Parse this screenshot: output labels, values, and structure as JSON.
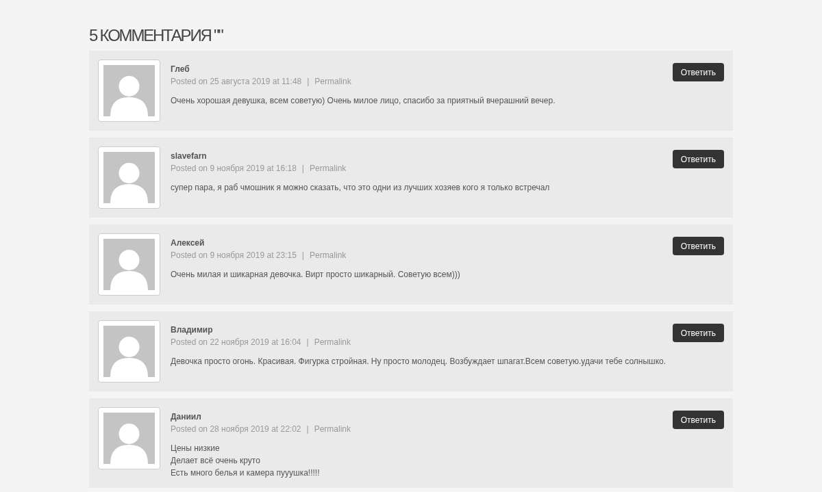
{
  "heading": "5 КОММЕНТАРИЯ \"\"",
  "comments": [
    {
      "author": "Глеб",
      "posted": "Posted on 25 августа 2019 at 11:48",
      "separator": "|",
      "permalink": "Permalink",
      "reply": "Ответить",
      "lines": [
        "Очень хорошая девушка, всем советую) Очень милое лицо, спасибо за приятный вчерашний вечер."
      ]
    },
    {
      "author": "slavefarn",
      "posted": "Posted on 9 ноября 2019 at 16:18",
      "separator": "|",
      "permalink": "Permalink",
      "reply": "Ответить",
      "lines": [
        "супер пара, я раб чмошник я можно сказать, что это одни из лучших хозяев кого я только встречал"
      ]
    },
    {
      "author": "Алексей",
      "posted": "Posted on 9 ноября 2019 at 23:15",
      "separator": "|",
      "permalink": "Permalink",
      "reply": "Ответить",
      "lines": [
        "Очень милая и шикарная девочка. Вирт просто шикарный. Советую всем)))"
      ]
    },
    {
      "author": "Владимир",
      "posted": "Posted on 22 ноября 2019 at 16:04",
      "separator": "|",
      "permalink": "Permalink",
      "reply": "Ответить",
      "lines": [
        "Девочка просто огонь. Красивая. Фигурка стройная. Ну просто молодец. Возбуждает шпагат.Всем советую.удачи тебе солнышко."
      ]
    },
    {
      "author": "Даниил",
      "posted": "Posted on 28 ноября 2019 at 22:02",
      "separator": "|",
      "permalink": "Permalink",
      "reply": "Ответить",
      "lines": [
        "Цены низкие",
        "Делает всё очень круто",
        "Есть много белья и камера пууушка!!!!!"
      ]
    }
  ]
}
